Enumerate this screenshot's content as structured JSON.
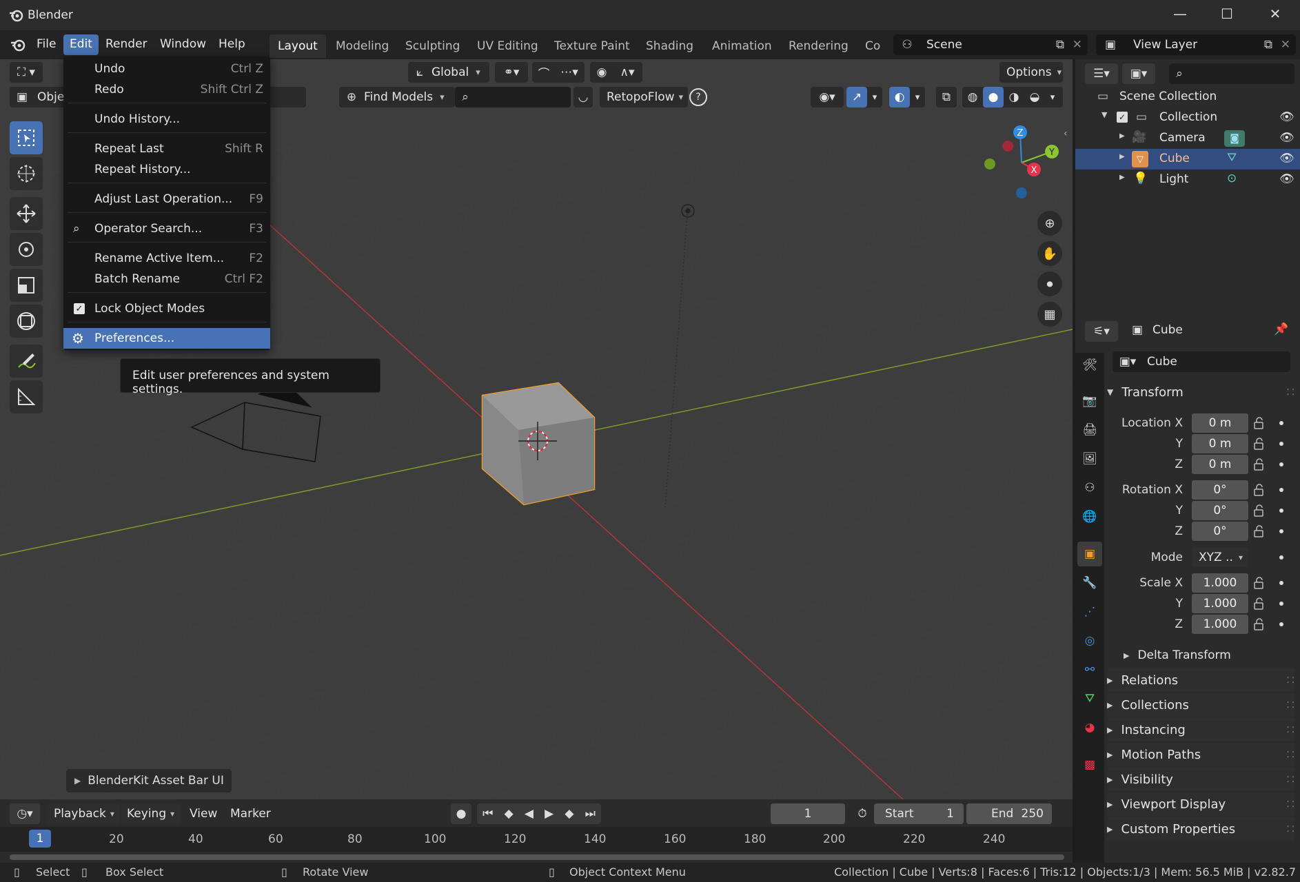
{
  "window": {
    "title": "Blender"
  },
  "menubar": {
    "items": [
      "File",
      "Edit",
      "Render",
      "Window",
      "Help"
    ],
    "workspaces": [
      "Layout",
      "Modeling",
      "Sculpting",
      "UV Editing",
      "Texture Paint",
      "Shading",
      "Animation",
      "Rendering",
      "Co"
    ],
    "scene": "Scene",
    "view_layer": "View Layer"
  },
  "viewport_header": {
    "mode_label": "Object",
    "transform_orientation": "Global",
    "find_models": "Find Models",
    "retopoflow": "RetopoFlow",
    "options": "Options"
  },
  "edit_menu": {
    "items": [
      {
        "label": "Undo",
        "shortcut": "Ctrl Z"
      },
      {
        "label": "Redo",
        "shortcut": "Shift Ctrl Z"
      },
      {
        "label": "Undo History...",
        "shortcut": ""
      },
      {
        "label": "Repeat Last",
        "shortcut": "Shift R"
      },
      {
        "label": "Repeat History...",
        "shortcut": ""
      },
      {
        "label": "Adjust Last Operation...",
        "shortcut": "F9"
      },
      {
        "label": "Operator Search...",
        "shortcut": "F3"
      },
      {
        "label": "Rename Active Item...",
        "shortcut": "F2"
      },
      {
        "label": "Batch Rename",
        "shortcut": "Ctrl F2"
      },
      {
        "label": "Lock Object Modes",
        "shortcut": ""
      },
      {
        "label": "Preferences...",
        "shortcut": ""
      }
    ],
    "tooltip": "Edit user preferences and system settings."
  },
  "blenderkit_bar": "BlenderKit Asset Bar UI",
  "outliner": {
    "scene_collection": "Scene Collection",
    "collection": "Collection",
    "objects": [
      "Camera",
      "Cube",
      "Light"
    ]
  },
  "properties": {
    "object_name": "Cube",
    "data_name": "Cube",
    "transform_title": "Transform",
    "location_label": "Location X",
    "rotation_label": "Rotation X",
    "scale_label": "Scale X",
    "y_label": "Y",
    "z_label": "Z",
    "mode_label": "Mode",
    "location": [
      "0 m",
      "0 m",
      "0 m"
    ],
    "rotation": [
      "0°",
      "0°",
      "0°"
    ],
    "mode": "XYZ ..",
    "scale": [
      "1.000",
      "1.000",
      "1.000"
    ],
    "delta_transform": "Delta Transform",
    "panels": [
      "Relations",
      "Collections",
      "Instancing",
      "Motion Paths",
      "Visibility",
      "Viewport Display",
      "Custom Properties"
    ]
  },
  "timeline": {
    "menus": [
      "Playback",
      "Keying",
      "View",
      "Marker"
    ],
    "current_frame": "1",
    "start_label": "Start",
    "start": "1",
    "end_label": "End",
    "end": "250",
    "ruler": [
      "1",
      "20",
      "40",
      "60",
      "80",
      "100",
      "120",
      "140",
      "160",
      "180",
      "200",
      "220",
      "240"
    ]
  },
  "statusbar": {
    "select": "Select",
    "box_select": "Box Select",
    "rotate_view": "Rotate View",
    "context_menu": "Object Context Menu",
    "info": "Collection | Cube | Verts:8 | Faces:6 | Tris:12 | Objects:1/3 | Mem: 56.5 MiB | v2.82.7"
  },
  "colors": {
    "accent": "#4772b3",
    "selection_outline": "#f29c2a",
    "axis_x": "#e9334b",
    "axis_y": "#8bc530",
    "axis_z": "#2c8fe3"
  }
}
